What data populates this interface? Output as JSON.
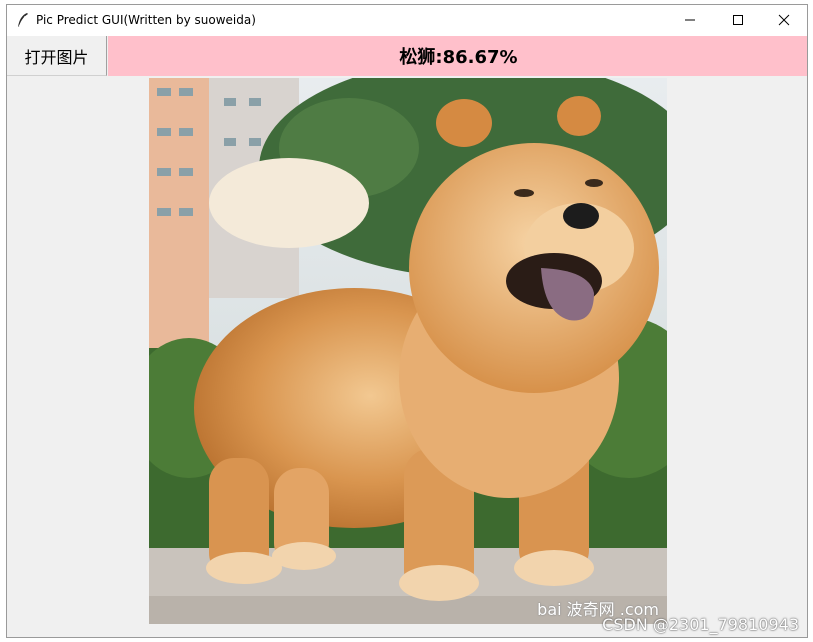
{
  "window": {
    "title": "Pic Predict GUI(Written by suoweida)"
  },
  "toolbar": {
    "open_button_label": "打开图片",
    "result_text": "松狮:86.67%"
  },
  "photo": {
    "watermark_text": "bai 波奇网 .com"
  },
  "page_watermark": "CSDN @2301_79810943",
  "colors": {
    "result_bar": "#ffc0cb",
    "window_bg": "#f0f0f0",
    "titlebar_bg": "#ffffff"
  },
  "icons": {
    "app": "feather-icon",
    "minimize": "minimize-icon",
    "maximize": "maximize-icon",
    "close": "close-icon"
  }
}
